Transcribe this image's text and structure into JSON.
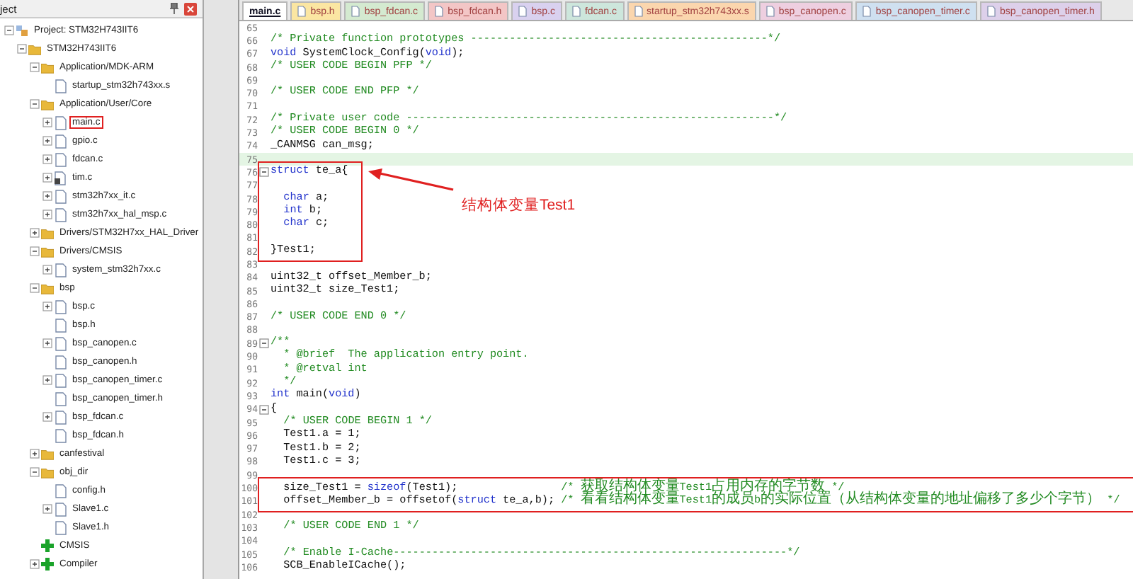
{
  "project_panel": {
    "title": "ject",
    "tree": [
      {
        "label": "Project: STM32H743IIT6",
        "kind": "project",
        "expanded": true,
        "children": [
          {
            "label": "STM32H743IIT6",
            "kind": "target",
            "expanded": true,
            "children": [
              {
                "label": "Application/MDK-ARM",
                "kind": "folder",
                "expanded": true,
                "children": [
                  {
                    "label": "startup_stm32h743xx.s",
                    "kind": "file"
                  }
                ]
              },
              {
                "label": "Application/User/Core",
                "kind": "folder",
                "expanded": true,
                "children": [
                  {
                    "label": "main.c",
                    "kind": "file",
                    "expanded": false,
                    "annotated": true
                  },
                  {
                    "label": "gpio.c",
                    "kind": "file",
                    "expanded": false
                  },
                  {
                    "label": "fdcan.c",
                    "kind": "file",
                    "expanded": false
                  },
                  {
                    "label": "tim.c",
                    "kind": "locked",
                    "expanded": false
                  },
                  {
                    "label": "stm32h7xx_it.c",
                    "kind": "file",
                    "expanded": false
                  },
                  {
                    "label": "stm32h7xx_hal_msp.c",
                    "kind": "file",
                    "expanded": false
                  }
                ]
              },
              {
                "label": "Drivers/STM32H7xx_HAL_Driver",
                "kind": "folder",
                "expanded": false
              },
              {
                "label": "Drivers/CMSIS",
                "kind": "folder",
                "expanded": true,
                "children": [
                  {
                    "label": "system_stm32h7xx.c",
                    "kind": "file",
                    "expanded": false
                  }
                ]
              },
              {
                "label": "bsp",
                "kind": "folder",
                "expanded": true,
                "children": [
                  {
                    "label": "bsp.c",
                    "kind": "file",
                    "expanded": false
                  },
                  {
                    "label": "bsp.h",
                    "kind": "file"
                  },
                  {
                    "label": "bsp_canopen.c",
                    "kind": "file",
                    "expanded": false
                  },
                  {
                    "label": "bsp_canopen.h",
                    "kind": "file"
                  },
                  {
                    "label": "bsp_canopen_timer.c",
                    "kind": "file",
                    "expanded": false
                  },
                  {
                    "label": "bsp_canopen_timer.h",
                    "kind": "file"
                  },
                  {
                    "label": "bsp_fdcan.c",
                    "kind": "file",
                    "expanded": false
                  },
                  {
                    "label": "bsp_fdcan.h",
                    "kind": "file"
                  }
                ]
              },
              {
                "label": "canfestival",
                "kind": "folder",
                "expanded": false
              },
              {
                "label": "obj_dir",
                "kind": "folder",
                "expanded": true,
                "children": [
                  {
                    "label": "config.h",
                    "kind": "file"
                  },
                  {
                    "label": "Slave1.c",
                    "kind": "file",
                    "expanded": false
                  },
                  {
                    "label": "Slave1.h",
                    "kind": "file"
                  }
                ]
              },
              {
                "label": "CMSIS",
                "kind": "component"
              },
              {
                "label": "Compiler",
                "kind": "component",
                "expanded": false
              }
            ]
          }
        ]
      }
    ]
  },
  "tabs": [
    {
      "label": "main.c",
      "selected": true
    },
    {
      "label": "bsp.h",
      "selected": false,
      "color": "#fbe6a2"
    },
    {
      "label": "bsp_fdcan.c",
      "selected": false,
      "color": "#d4ead0"
    },
    {
      "label": "bsp_fdcan.h",
      "selected": false,
      "color": "#f3c6c6"
    },
    {
      "label": "bsp.c",
      "selected": false,
      "color": "#d9d1ef"
    },
    {
      "label": "fdcan.c",
      "selected": false,
      "color": "#cde6dc"
    },
    {
      "label": "startup_stm32h743xx.s",
      "selected": false,
      "color": "#fbd6ae"
    },
    {
      "label": "bsp_canopen.c",
      "selected": false,
      "color": "#eecfe0"
    },
    {
      "label": "bsp_canopen_timer.c",
      "selected": false,
      "color": "#cfe0f0"
    },
    {
      "label": "bsp_canopen_timer.h",
      "selected": false,
      "color": "#ddd0ea"
    }
  ],
  "editor": {
    "sections": [
      {
        "lines": [
          {
            "number": "65"
          },
          {
            "number": "66",
            "parts": [
              {
                "kind": "comment",
                "text": "/* Private function prototypes ----------------------------------------------*/"
              }
            ]
          },
          {
            "number": "67",
            "parts": [
              {
                "kind": "keyword",
                "text": "void"
              },
              {
                "kind": "code",
                "text": " SystemClock_Config("
              },
              {
                "kind": "keyword",
                "text": "void"
              },
              {
                "kind": "code",
                "text": ");"
              }
            ]
          },
          {
            "number": "68",
            "parts": [
              {
                "kind": "comment",
                "text": "/* USER CODE BEGIN PFP */"
              }
            ]
          },
          {
            "number": "69"
          },
          {
            "number": "70",
            "parts": [
              {
                "kind": "comment",
                "text": "/* USER CODE END PFP */"
              }
            ]
          },
          {
            "number": "71"
          },
          {
            "number": "72",
            "parts": [
              {
                "kind": "comment",
                "text": "/* Private user code ---------------------------------------------------------*/"
              }
            ]
          },
          {
            "number": "73",
            "parts": [
              {
                "kind": "comment",
                "text": "/* USER CODE BEGIN 0 */"
              }
            ]
          },
          {
            "number": "74",
            "parts": [
              {
                "kind": "code",
                "text": "_CANMSG can_msg;"
              }
            ]
          },
          {
            "number": "75",
            "current": true
          }
        ]
      },
      {
        "boxed": true,
        "callout": "结构体变量Test1",
        "lines": [
          {
            "number": "76",
            "fold": true,
            "parts": [
              {
                "kind": "keyword",
                "text": "struct"
              },
              {
                "kind": "code",
                "text": " te_a{"
              }
            ]
          },
          {
            "number": "77"
          },
          {
            "number": "78",
            "indented": true,
            "parts": [
              {
                "kind": "keyword",
                "text": "char"
              },
              {
                "kind": "code",
                "text": " a;"
              }
            ]
          },
          {
            "number": "79",
            "indented": true,
            "parts": [
              {
                "kind": "keyword",
                "text": "int"
              },
              {
                "kind": "code",
                "text": " b;"
              }
            ]
          },
          {
            "number": "80",
            "indented": true,
            "parts": [
              {
                "kind": "keyword",
                "text": "char"
              },
              {
                "kind": "code",
                "text": " c;"
              }
            ]
          },
          {
            "number": "81"
          },
          {
            "number": "82",
            "parts": [
              {
                "kind": "code",
                "text": "}Test1;"
              }
            ]
          }
        ]
      },
      {
        "lines": [
          {
            "number": "83"
          },
          {
            "number": "84",
            "parts": [
              {
                "kind": "code",
                "text": "uint32_t offset_Member_b;"
              }
            ]
          },
          {
            "number": "85",
            "parts": [
              {
                "kind": "code",
                "text": "uint32_t size_Test1;"
              }
            ]
          },
          {
            "number": "86"
          },
          {
            "number": "87",
            "parts": [
              {
                "kind": "comment",
                "text": "/* USER CODE END 0 */"
              }
            ]
          },
          {
            "number": "88"
          },
          {
            "number": "89",
            "fold": true,
            "parts": [
              {
                "kind": "comment",
                "text": "/**"
              }
            ]
          },
          {
            "number": "90",
            "parts": [
              {
                "kind": "comment",
                "text": "  * @brief  The application entry point."
              }
            ]
          },
          {
            "number": "91",
            "parts": [
              {
                "kind": "comment",
                "text": "  * @retval int"
              }
            ]
          },
          {
            "number": "92",
            "parts": [
              {
                "kind": "comment",
                "text": "  */"
              }
            ]
          },
          {
            "number": "93",
            "parts": [
              {
                "kind": "keyword",
                "text": "int"
              },
              {
                "kind": "code",
                "text": " main("
              },
              {
                "kind": "keyword",
                "text": "void"
              },
              {
                "kind": "code",
                "text": ")"
              }
            ]
          },
          {
            "number": "94",
            "fold": true,
            "parts": [
              {
                "kind": "code",
                "text": "{"
              }
            ]
          },
          {
            "number": "95",
            "indented": true,
            "parts": [
              {
                "kind": "comment",
                "text": "/* USER CODE BEGIN 1 */"
              }
            ]
          },
          {
            "number": "96",
            "parts": [
              {
                "kind": "code",
                "text": "  Test1.a = 1;"
              }
            ]
          },
          {
            "number": "97",
            "parts": [
              {
                "kind": "code",
                "text": "  Test1.b = 2;"
              }
            ]
          },
          {
            "number": "98",
            "parts": [
              {
                "kind": "code",
                "text": "  Test1.c = 3;"
              }
            ]
          },
          {
            "number": "99"
          }
        ]
      },
      {
        "boxed": true,
        "lines": [
          {
            "number": "100",
            "parts": [
              {
                "kind": "code",
                "text": "  size_Test1 = "
              },
              {
                "kind": "keyword",
                "text": "sizeof"
              },
              {
                "kind": "code",
                "text": "(Test1);                "
              },
              {
                "kind": "comment",
                "text": "/* 获取结构体变量Test1占用内存的字节数 */"
              }
            ]
          },
          {
            "number": "101",
            "parts": [
              {
                "kind": "code",
                "text": "  offset_Member_b = offsetof("
              },
              {
                "kind": "keyword",
                "text": "struct"
              },
              {
                "kind": "code",
                "text": " te_a,b); "
              },
              {
                "kind": "comment",
                "text": "/* 看看结构体变量Test1的成员b的实际位置（从结构体变量的地址偏移了多少个字节） */"
              }
            ]
          }
        ]
      },
      {
        "lines": [
          {
            "number": "102"
          },
          {
            "number": "103",
            "indented": true,
            "parts": [
              {
                "kind": "comment",
                "text": "/* USER CODE END 1 */"
              }
            ]
          },
          {
            "number": "104"
          },
          {
            "number": "105",
            "indented": true,
            "parts": [
              {
                "kind": "comment",
                "text": "/* Enable I-Cache-------------------------------------------------------------*/"
              }
            ]
          },
          {
            "number": "106",
            "parts": [
              {
                "kind": "code",
                "text": "  SCB_EnableICache();"
              }
            ]
          }
        ]
      }
    ]
  }
}
